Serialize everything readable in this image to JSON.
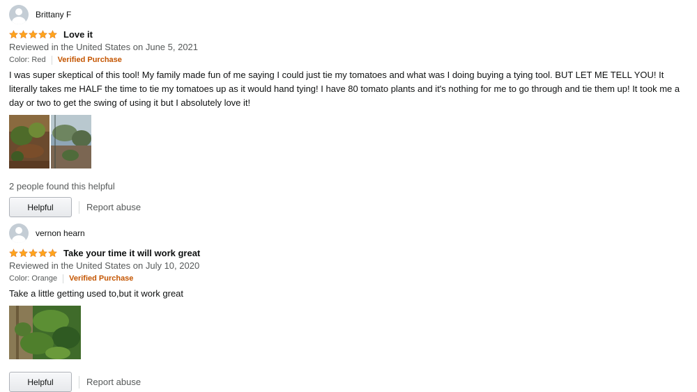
{
  "reviews": [
    {
      "author": "Brittany F",
      "rating": 5,
      "title": "Love it",
      "date_line": "Reviewed in the United States on June 5, 2021",
      "color_label": "Color: Red",
      "verified": "Verified Purchase",
      "body": "I was super skeptical of this tool! My family made fun of me saying I could just tie my tomatoes and what was I doing buying a tying tool. BUT LET ME TELL YOU! It literally takes me HALF the time to tie my tomatoes up as it would hand tying! I have 80 tomato plants and it's nothing for me to go through and tie them up! It took me a day or two to get the swing of using it but I absolutely love it!",
      "helpful_count": "2 people found this helpful",
      "helpful_label": "Helpful",
      "report_label": "Report abuse"
    },
    {
      "author": "vernon hearn",
      "rating": 5,
      "title": "Take your time it will work great",
      "date_line": "Reviewed in the United States on July 10, 2020",
      "color_label": "Color: Orange",
      "verified": "Verified Purchase",
      "body": "Take a little getting used to,but it work great",
      "helpful_label": "Helpful",
      "report_label": "Report abuse"
    }
  ],
  "colors": {
    "star": "#ffa41c",
    "verified": "#c45500",
    "muted": "#565959"
  }
}
